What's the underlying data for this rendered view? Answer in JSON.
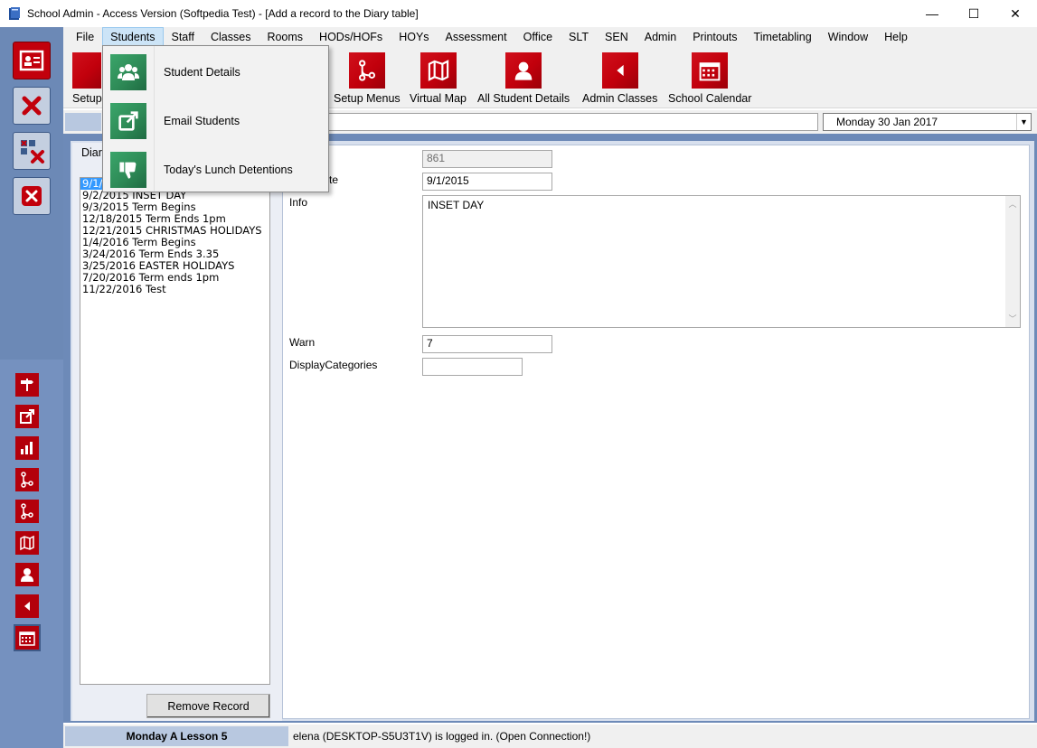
{
  "window": {
    "title": "School Admin - Access Version (Softpedia Test) - [Add a record to the Diary table]",
    "minimize": "—",
    "maximize": "☐",
    "close": "✕"
  },
  "menu": [
    "File",
    "Students",
    "Staff",
    "Classes",
    "Rooms",
    "HODs/HOFs",
    "HOYs",
    "Assessment",
    "Office",
    "SLT",
    "SEN",
    "Admin",
    "Printouts",
    "Timetabling",
    "Window",
    "Help"
  ],
  "toolbar": {
    "setup_partial": "Setup",
    "tools": [
      {
        "label": "Setup Menus",
        "icon": "flow-icon"
      },
      {
        "label": "Virtual Map",
        "icon": "map-icon"
      },
      {
        "label": "All Student Details",
        "icon": "user-icon"
      },
      {
        "label": "Admin Classes",
        "icon": "back-arrow-icon"
      },
      {
        "label": "School Calendar",
        "icon": "calendar-icon"
      }
    ]
  },
  "date_combo": {
    "value": "Monday   30 Jan 2017",
    "arrow": "▼"
  },
  "students_menu": {
    "items": [
      {
        "label": "Student Details",
        "icon": "group-icon"
      },
      {
        "label": "Email Students",
        "icon": "external-link-icon"
      },
      {
        "label": "Today's Lunch Detentions",
        "icon": "thumbs-down-icon"
      }
    ]
  },
  "diary_panel": {
    "title_partial": "Diar",
    "selected_partial": "9/1/",
    "rows": [
      "9/2/2015 INSET DAY",
      "9/3/2015 Term Begins",
      "12/18/2015 Term Ends 1pm",
      "12/21/2015 CHRISTMAS HOLIDAYS",
      "1/4/2016 Term Begins",
      "3/24/2016 Term Ends 3.35",
      "3/25/2016 EASTER HOLIDAYS",
      "7/20/2016 Term ends 1pm",
      "11/22/2016 Test"
    ],
    "remove_button": "Remove Record"
  },
  "form": {
    "id_value": "861",
    "date_label_partial": "te",
    "date_value": "9/1/2015",
    "info_label": "Info",
    "info_value": "INSET DAY",
    "warn_label": "Warn",
    "warn_value": "7",
    "display_categories_label": "DisplayCategories",
    "display_categories_value": ""
  },
  "status": {
    "lesson": "Monday A Lesson 5",
    "message": "elena (DESKTOP-S5U3T1V) is logged in. (Open Connection!)"
  },
  "colors": {
    "accent_red": "#c2000c",
    "accent_green": "#2e8b57",
    "frame_blue": "#6d8ab8"
  }
}
